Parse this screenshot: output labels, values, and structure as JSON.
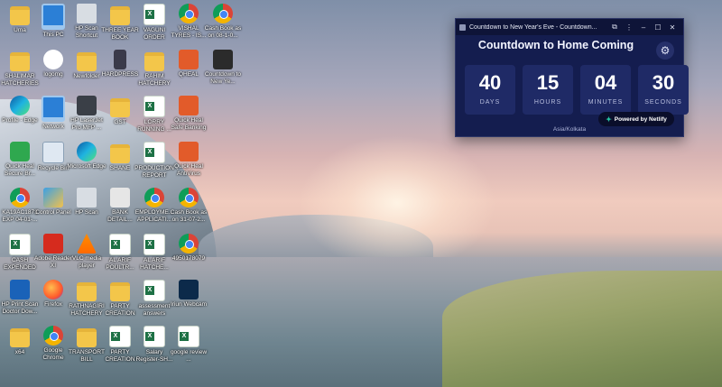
{
  "desktop_icons": [
    {
      "label": "Uma",
      "glyph": "folder"
    },
    {
      "label": "This PC",
      "glyph": "monitor"
    },
    {
      "label": "HP Scan Shortcut",
      "glyph": "scanner"
    },
    {
      "label": "THREE YEAR BOOK",
      "glyph": "folder"
    },
    {
      "label": "VAGUNI ORDER",
      "glyph": "excel"
    },
    {
      "label": "VISHAL TYRES - IS...",
      "glyph": "chrome"
    },
    {
      "label": "Cash Book as on 08-1-0...",
      "glyph": "chrome"
    },
    {
      "label": "SHALIMAR HATCHERIES",
      "glyph": "folder"
    },
    {
      "label": "logomg",
      "glyph": "shalimar"
    },
    {
      "label": "Newfolder",
      "glyph": "folder"
    },
    {
      "label": "HARDPRESS",
      "glyph": "phone"
    },
    {
      "label": "RAHIM HATCHERY",
      "glyph": "folder"
    },
    {
      "label": "QHEAL",
      "glyph": "qheal"
    },
    {
      "label": "Countdown to New Ye...",
      "glyph": "dark"
    },
    {
      "label": "Profile - Edge",
      "glyph": "edge"
    },
    {
      "label": "Network",
      "glyph": "monitor"
    },
    {
      "label": "HP LaserJet Pro MFP ...",
      "glyph": "printer"
    },
    {
      "label": "GST",
      "glyph": "folder"
    },
    {
      "label": "LORRY RUNNING ...",
      "glyph": "excel"
    },
    {
      "label": "Quick Heal Safe Banking",
      "glyph": "qheal"
    },
    {
      "label": "Quick Heal Secure Br...",
      "glyph": "green"
    },
    {
      "label": "Recycle Bin",
      "glyph": "bin"
    },
    {
      "label": "Microsoft Edge",
      "glyph": "edge"
    },
    {
      "label": "SHANE",
      "glyph": "folder"
    },
    {
      "label": "PRODUCTION REPORT",
      "glyph": "excel"
    },
    {
      "label": "Quick Heal AntiVirus",
      "glyph": "qheal"
    },
    {
      "label": "KA19AC1873 EXP 04-01-...",
      "glyph": "chrome"
    },
    {
      "label": "Control Panel",
      "glyph": "cpanel"
    },
    {
      "label": "HP Scan",
      "glyph": "scanner"
    },
    {
      "label": "BANK DETAIL...",
      "glyph": "bank"
    },
    {
      "label": "EMPLOYME... APPLICATI...",
      "glyph": "chrome"
    },
    {
      "label": "Cash Book as on 31-07-2...",
      "glyph": "chrome"
    },
    {
      "label": "CASH EXPENDED",
      "glyph": "excel"
    },
    {
      "label": "Adobe Reader XI",
      "glyph": "pdf"
    },
    {
      "label": "VLC media player",
      "glyph": "vlc"
    },
    {
      "label": "AL ARIF POULTR...",
      "glyph": "excel"
    },
    {
      "label": "AL ARIF HATCHE...",
      "glyph": "excel"
    },
    {
      "label": "4950178079",
      "glyph": "chrome"
    },
    {
      "label": "HP Print Scan Doctor Dow...",
      "glyph": "hp"
    },
    {
      "label": "Firefox",
      "glyph": "firefox"
    },
    {
      "label": "RATHNAGIRI HATCHERY",
      "glyph": "folder"
    },
    {
      "label": "PARTY CREATION",
      "glyph": "folder"
    },
    {
      "label": "assessment answers",
      "glyph": "excel"
    },
    {
      "label": "Iriun Webcam",
      "glyph": "webcam"
    },
    {
      "label": "x64",
      "glyph": "folder"
    },
    {
      "label": "Google Chrome",
      "glyph": "chrome"
    },
    {
      "label": "TRANSPORT BILL",
      "glyph": "folder"
    },
    {
      "label": "PARTY CREATION",
      "glyph": "excel"
    },
    {
      "label": "Salary Register-SH...",
      "glyph": "excel"
    },
    {
      "label": "google review ...",
      "glyph": "excel"
    }
  ],
  "widget": {
    "window_title": "Countdown to New Year's Eve - Countdown...",
    "heading": "Countdown to Home Coming",
    "units": [
      {
        "value": "40",
        "label": "DAYS"
      },
      {
        "value": "15",
        "label": "HOURS"
      },
      {
        "value": "04",
        "label": "MINUTES"
      },
      {
        "value": "30",
        "label": "SECONDS"
      }
    ],
    "badge": "Powered by Netlify",
    "timezone": "Asia/Kolkata"
  }
}
